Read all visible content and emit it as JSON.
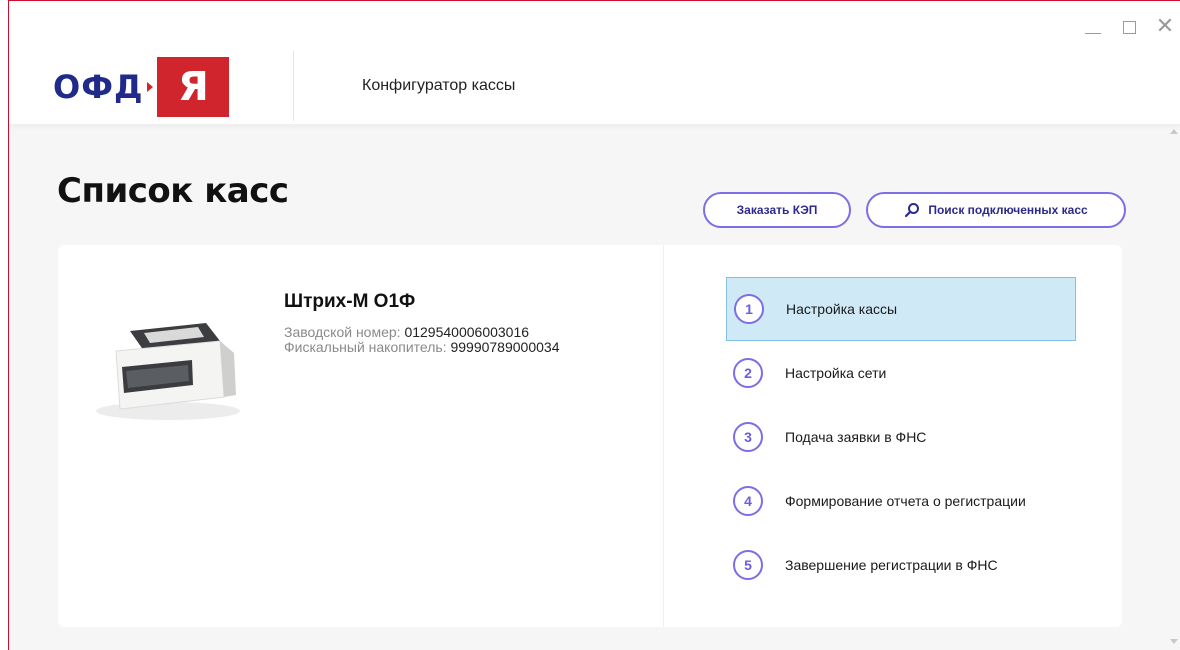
{
  "header": {
    "logo_text": "ОФД",
    "logo_letter": "Я",
    "app_title": "Конфигуратор кассы",
    "window_controls": [
      "minimize-icon",
      "maximize-icon",
      "close-icon"
    ],
    "close_glyph": "✕"
  },
  "page": {
    "title": "Список касс",
    "order_kep_label": "Заказать КЭП",
    "search_label": "Поиск подключенных касс"
  },
  "device": {
    "name": "Штрих-М О1Ф",
    "serial_label": "Заводской номер:",
    "serial_value": "0129540006003016",
    "fn_label": "Фискальный накопитель:",
    "fn_value": "99990789000034"
  },
  "steps": [
    {
      "num": "1",
      "label": "Настройка кассы",
      "active": true
    },
    {
      "num": "2",
      "label": "Настройка сети",
      "active": false
    },
    {
      "num": "3",
      "label": "Подача заявки в ФНС",
      "active": false
    },
    {
      "num": "4",
      "label": "Формирование отчета о регистрации",
      "active": false
    },
    {
      "num": "5",
      "label": "Завершение регистрации в ФНС",
      "active": false
    }
  ],
  "colors": {
    "brand_red": "#d1252e",
    "brand_blue": "#1f2a8a",
    "accent_purple": "#7b6ee6",
    "active_step_bg": "#cfe9f7"
  }
}
